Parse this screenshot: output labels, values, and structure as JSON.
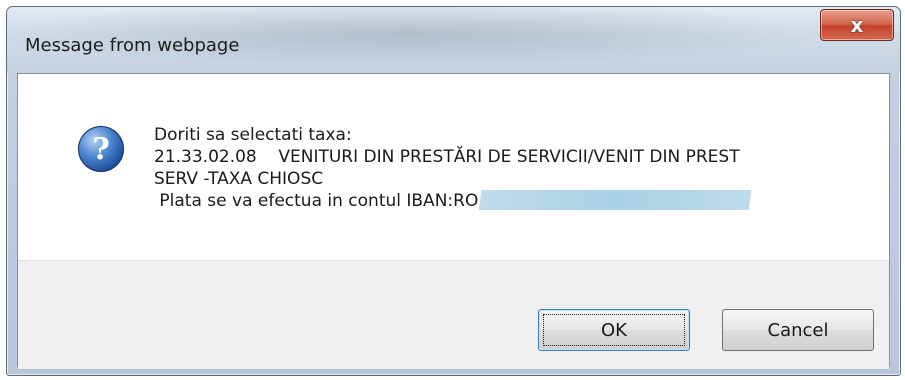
{
  "window": {
    "title": "Message from webpage",
    "close_label": "x"
  },
  "message": {
    "icon": "question-icon",
    "lines": [
      "Doriti sa selectati taxa:",
      "21.33.02.08    VENITURI DIN PRESTĂRI DE SERVICII/VENIT DIN PREST",
      "SERV -TAXA CHIOSC",
      " Plata se va efectua in contul IBAN:RO"
    ]
  },
  "buttons": {
    "ok": "OK",
    "cancel": "Cancel"
  }
}
